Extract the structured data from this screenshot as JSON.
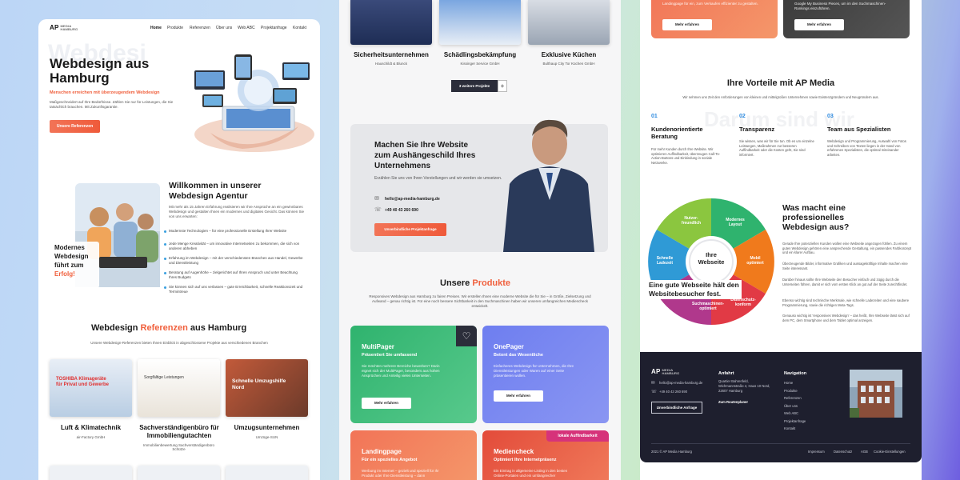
{
  "left": {
    "logo": {
      "mark": "AP",
      "word": "MEDIA",
      "sub": "HAMBURG"
    },
    "nav": [
      "Home",
      "Produkte",
      "Referenzen",
      "Über uns",
      "Web ABC",
      "Projektanfrage",
      "Kontakt"
    ],
    "hero": {
      "ghost": "Webdesi",
      "title1": "Webdesign aus",
      "title2": "Hamburg",
      "tagline": "Menschen erreichen mit überzeugendem Webdesign",
      "text": "Maßgeschneidert auf Ihre Bedürfnisse. Zählen Sie nur für Leistungen, die Sie tatsächlich brauchen. Mit Zukunftsgarantie.",
      "button": "Unsere Referenzen"
    },
    "welcome": {
      "title1": "Willkommen in unserer",
      "title2": "Webdesign Agentur",
      "text": "Mit mehr als 15 Jahren Erfahrung realisieren wir Ihre Ansprüche an ein gewinnbares Webdesign und gestalten Ihnen ein modernes und digitales Gesicht. Das können Sie von uns erwarten:",
      "bullets": [
        "Modernste Technologien – für eine professionelle Erstellung Ihrer Website",
        "Jede Menge Kreativität – um innovative Internetseiten zu bekommen, die sich von anderen abheben",
        "Erfahrung im Webdesign – mit der verschiedensten Branchen aus Handel, Gewerbe und Dienstleistung",
        "Beratung auf Augenhöhe – zielgerichtet auf Ihren Anspruch und unter Beachtung Ihres Budgets",
        "Sie können sich auf uns verlassen – gute Erreichbarkeit, schnelle Reaktionszeit und Termintreue"
      ],
      "badge1": "Modernes",
      "badge2": "Webdesign",
      "badge3": "führt zum",
      "badge4": "Erfolg!"
    },
    "refs": {
      "title1": "Webdesign",
      "title2": "Referenzen",
      "title3": "aus Hamburg",
      "sub": "Unsere Webdesign-Referenzen bieten Ihnen Einblick in abgeschlossene Projekte aus verschiedenen Branchen",
      "items": [
        {
          "name": "Luft & Klimatechnik",
          "client": "air-Factory GmbH",
          "shot": "TOSHIBA Klimageräte für Privat und Gewerbe"
        },
        {
          "name": "Sachverständigenbüro für Immobiliengutachten",
          "client": "Immobilienbewertung Sachverständigenbüro Schütze",
          "shot": "Sorgfältige Leistungen"
        },
        {
          "name": "Umzugsunternehmen",
          "client": "Umzüge-SUN",
          "shot": "Schnelle Umzugshilfe Nord"
        }
      ]
    }
  },
  "middle": {
    "top": [
      {
        "name": "Sicherheitsunternehmen",
        "client": "Hauschildt & Blunck"
      },
      {
        "name": "Schädlingsbekämpfung",
        "client": "Kissinger Service GmbH"
      },
      {
        "name": "Exklusive Küchen",
        "client": "Bulthaup City Tor Küchen GmbH"
      }
    ],
    "more": "3 weitere Projekte",
    "plus": "+",
    "cta": {
      "title1": "Machen Sie Ihre Website",
      "title2": "zum Aushängeschild Ihres",
      "title3": "Unternehmens",
      "text": "Erzählen Sie uns von Ihren Vorstellungen und wir werden sie umsetzen.",
      "email": "hello@ap-media-hamburg.de",
      "phone": "+49 40 43 260 690",
      "button": "Unverbindliche Projektanfrage"
    },
    "products": {
      "title1": "Unsere",
      "title2": "Produkte",
      "text": "Responsives Webdesign aus Hamburg zu fairen Preisen. Wir erstellen Ihnen eine moderne Website die für Sie – in Größe, Zielsetzung und Aufwand – genau richtig ist. Für eine noch bessere Sichtbarkeit in den Suchmaschinen haben wir unseren umfangreichen Mediencheck entwickelt.",
      "items": [
        {
          "title": "MultiPager",
          "sub": "Präsentiert Sie umfassend",
          "text": "Sie möchten mehrere Bereiche bewerben? Darin eignet sich der MultiPager, besonders aus hohen Ansprüchen und Anteilig vielen Unterseiten.",
          "button": "Mehr erfahren"
        },
        {
          "title": "OnePager",
          "sub": "Betont das Wesentliche",
          "text": "Einfacheres Webdesign für Unternehmen, die Ihre Dienstleistungen oder Waren auf einer Seite präsentieren wollen.",
          "button": "Mehr erfahren"
        },
        {
          "title": "Landingpage",
          "sub": "Für ein spezielles Angebot",
          "text": "Werbung im Internet – gezielt und speziell für Ihr Produkt oder Ihre Dienstleistung – dann",
          "button": ""
        },
        {
          "title": "Mediencheck",
          "sub": "Optimiert Ihre Internetpräsenz",
          "text": "Ein Eintrag in allgemeine Listing in den besten Online-Portalen und ein umfangreicher",
          "button": "",
          "tag": "lokale Auffindbarkeit"
        }
      ]
    }
  },
  "right": {
    "top": [
      {
        "text": "Landingpage für ein, zum Verkaufen effizienter zu gestalten.",
        "button": "Mehr erfahren"
      },
      {
        "text": "Google My Business Pieces, um im den Suchmaschinen-Rankings einzuführen.",
        "button": "Mehr erfahren"
      }
    ],
    "adv": {
      "title": "Ihre Vorteile mit AP Media",
      "sub": "Wir nehmen uns Zeit den Anforderungen von kleinen und mittelgroßen Unternehmen sowie Existenzgründern und Neugründern aus.",
      "ghost": "Darum sind wir",
      "items": [
        {
          "num": "01",
          "title": "Kundenorientierte Beratung",
          "text": "Für mehr Kunden durch Ihre Website. Wir optimieren Auffindbarkeit, überzeugen Call-To-Action-Buttons und Einbindung in soziale Netzwerke."
        },
        {
          "num": "02",
          "title": "Transparenz",
          "text": "Sie wissen, was wir für Sie tun. Ob es um einzelne Leistungen, Maßnahmen zur besseren Auffindbarkeit oder die Kosten geht, Sie sind informiert."
        },
        {
          "num": "03",
          "title": "Team aus Spezialisten",
          "text": "Webdesign und Programmierung, Auswahl von Fotos und Schreiben von Texten liegen in der Hand von erfahrenen Spezialisten, die optimal miteinander arbeiten."
        }
      ]
    },
    "wheel": {
      "center1": "Ihre",
      "center2": "Webseite",
      "s1": "Nutzer-freundlich",
      "s2": "Modernes Layout",
      "s3": "Mobil optimiert",
      "s4": "Datenschutz-konform",
      "s5": "Suchmaschinen-optimiert",
      "s6": "Schnelle Ladezeit",
      "banner1": "Eine gute Webseite hält den",
      "banner2": "Websitebesucher fest."
    },
    "why": {
      "title1": "Was macht eine",
      "title2": "professionelles",
      "title3": "Webdesign aus?",
      "paras": [
        "Gerade Ihre potenziellen Kunden wollen eine Webseite angezogen fühlen. Zu einem guten Webdesign gehören eine ansprechende Gestaltung, ein passendes Farbkonzept und ein klarer Aufbau.",
        "Überzeugende Bilder, informative Grafiken und aussagekräftige Inhalte machen eine Seite interessant.",
        "Darüber hinaus sollte Ihre Webseite den Besucher einfach und zügig durch die Unterseiten führen, damit er sich vom ersten Klick an gut auf der Seite zurechtfindet.",
        "Ebenso wichtig sind technische Merkmale, wie schnelle Ladezeiten und eine saubere Programmierung, sowie die richtigen Meta-Tags.",
        "Genauso wichtig ist 'responsives Webdesign' – das heißt, Ihre Webseite lässt sich auf dem PC, dem Smartphone und dem Tablet optimal anzeigen."
      ]
    },
    "footer": {
      "email": "hello@ap-media-hamburg.de",
      "phone": "+49 40 43 260 690",
      "button": "Unverbindliche Anfrage",
      "anfahrt": "Anfahrt",
      "address": "Quartier Bahrenfeld, Wichmannstraße 4, Haus 10 Nord, 22607 Hamburg",
      "route": "Zum Routenplaner",
      "navTitle": "Navigation",
      "nav": [
        "Home",
        "Produkte",
        "Referenzen",
        "Über uns",
        "Web ABC",
        "Projektanfrage",
        "Kontakt"
      ],
      "copy": "2021 © AP Media Hamburg",
      "links": [
        "Impressum",
        "Datenschutz",
        "AGB",
        "Cookie-Einstellungen"
      ]
    }
  },
  "colors": {
    "accent": "#f0603d",
    "blue": "#2f8be0",
    "footer": "#1e1f2e",
    "green": "#2fb36e",
    "violet": "#6e7ef0"
  }
}
